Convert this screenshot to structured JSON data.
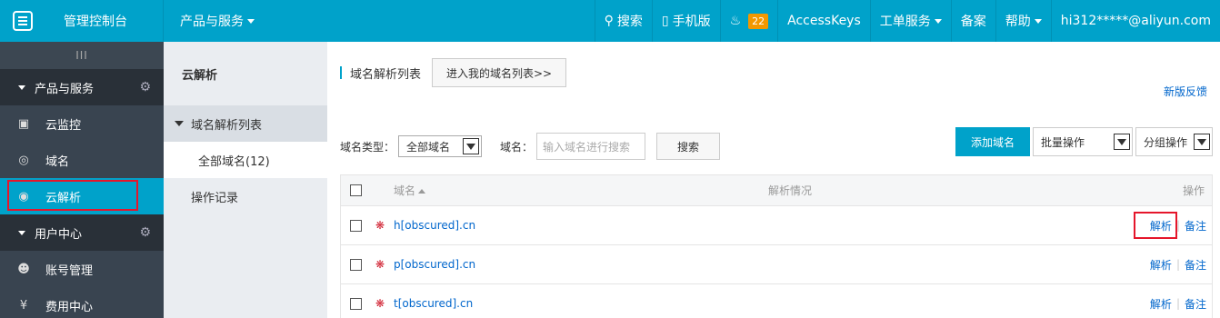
{
  "topbar": {
    "console_label": "管理控制台",
    "products_label": "产品与服务",
    "search_label": "搜索",
    "mobile_label": "手机版",
    "notification_count": "22",
    "accesskeys_label": "AccessKeys",
    "ticket_label": "工单服务",
    "beian_label": "备案",
    "help_label": "帮助",
    "account_label": "hi312*****@aliyun.com"
  },
  "leftnav": {
    "collapse_glyph": "III",
    "group_products": "产品与服务",
    "items": [
      {
        "label": "云监控"
      },
      {
        "label": "域名"
      },
      {
        "label": "云解析"
      }
    ],
    "group_user": "用户中心",
    "user_items": [
      {
        "label": "账号管理"
      },
      {
        "label": "费用中心"
      }
    ]
  },
  "subnav": {
    "title": "云解析",
    "group_label": "域名解析列表",
    "sub_item": "全部域名(12)",
    "item_log": "操作记录"
  },
  "main": {
    "page_title": "域名解析列表",
    "goto_button": "进入我的域名列表>>",
    "feedback_link": "新版反馈",
    "filter": {
      "type_label": "域名类型：",
      "type_value": "全部域名",
      "domain_label": "域名：",
      "domain_placeholder": "输入域名进行搜索",
      "search_button": "搜索",
      "add_button": "添加域名",
      "batch_select": "批量操作",
      "group_select": "分组操作"
    },
    "table": {
      "headers": {
        "domain": "域名",
        "status": "解析情况",
        "op": "操作"
      },
      "rows": [
        {
          "domain": "h[obscured].cn",
          "op1": "解析",
          "op2": "备注"
        },
        {
          "domain": "p[obscured].cn",
          "op1": "解析",
          "op2": "备注"
        },
        {
          "domain": "t[obscured].cn",
          "op1": "解析",
          "op2": "备注"
        }
      ]
    }
  },
  "colors": {
    "brand": "#00a2ca",
    "nav_dark": "#293038",
    "link": "#0066cc",
    "highlight_red": "#e5162b",
    "badge": "#f39800"
  }
}
